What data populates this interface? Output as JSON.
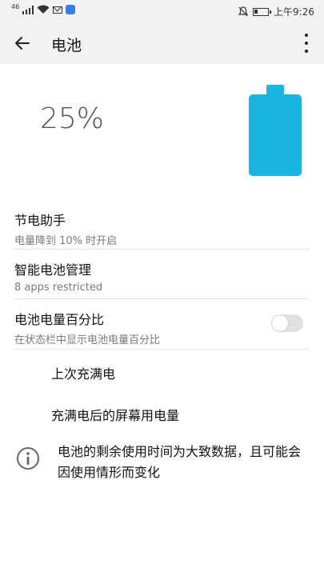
{
  "status_bar": {
    "signal_text": "46",
    "time": "上午9:26",
    "icons": [
      "signal-icon",
      "wifi-icon",
      "mail-icon",
      "app-badge-icon",
      "mute-bell-icon",
      "battery-icon"
    ]
  },
  "header": {
    "title": "电池",
    "back_icon": "arrow-left-icon",
    "more_icon": "more-vert-icon"
  },
  "battery": {
    "percent_text": "25%",
    "level": 0.25,
    "color": "#1cb4e0"
  },
  "settings": {
    "power_saver": {
      "title": "节电助手",
      "subtitle": "电量降到 10% 时开启"
    },
    "smart_battery": {
      "title": "智能电池管理",
      "subtitle": "8 apps restricted"
    },
    "battery_percent": {
      "title": "电池电量百分比",
      "subtitle": "在状态栏中显示电池电量百分比",
      "enabled": false
    }
  },
  "stats": {
    "last_full_charge": "上次充满电",
    "screen_usage": "充满电后的屏幕用电量"
  },
  "info": {
    "text": "电池的剩余使用时间为大致数据，且可能会因使用情形而变化"
  }
}
